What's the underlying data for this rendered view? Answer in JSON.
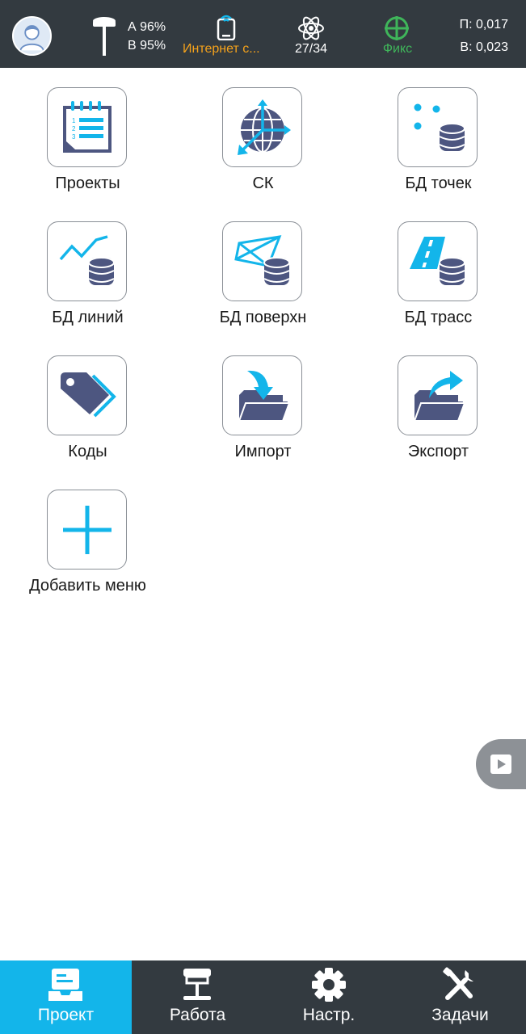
{
  "status": {
    "battery_a": "А 96%",
    "battery_b": "В 95%",
    "network_label": "Интернет с...",
    "satellites": "27/34",
    "solution": "Фикс",
    "precision_h": "П: 0,017",
    "precision_v": "В: 0,023"
  },
  "menu": [
    {
      "label": "Проекты",
      "icon": "projects-icon"
    },
    {
      "label": "СК",
      "icon": "coordinate-system-icon"
    },
    {
      "label": "БД точек",
      "icon": "points-db-icon"
    },
    {
      "label": "БД линий",
      "icon": "lines-db-icon"
    },
    {
      "label": "БД поверхн",
      "icon": "surfaces-db-icon"
    },
    {
      "label": "БД трасс",
      "icon": "roads-db-icon"
    },
    {
      "label": "Коды",
      "icon": "codes-tag-icon"
    },
    {
      "label": "Импорт",
      "icon": "import-folder-icon"
    },
    {
      "label": "Экспорт",
      "icon": "export-folder-icon"
    },
    {
      "label": "Добавить меню",
      "icon": "plus-icon"
    }
  ],
  "nav": [
    {
      "label": "Проект",
      "icon": "project-tray-icon",
      "active": true
    },
    {
      "label": "Работа",
      "icon": "rover-icon",
      "active": false
    },
    {
      "label": "Настр.",
      "icon": "gear-icon",
      "active": false
    },
    {
      "label": "Задачи",
      "icon": "tools-icon",
      "active": false
    }
  ],
  "colors": {
    "bar": "#333a40",
    "accent": "#13b5ea",
    "icon_navy": "#4d5680",
    "warning": "#f5a21b",
    "fix": "#3fb55a"
  }
}
